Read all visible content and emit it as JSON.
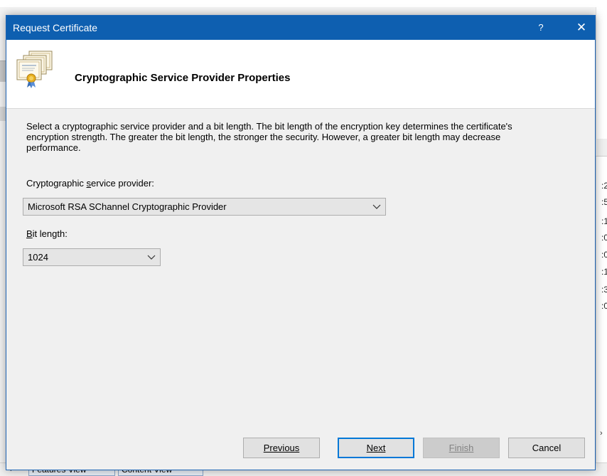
{
  "background": {
    "right_rows": [
      ":2",
      ":5",
      ":1",
      ":0",
      ":0",
      ":1",
      ":3",
      ":0"
    ],
    "bottom_tabs": [
      "Features View",
      "Content View"
    ]
  },
  "dialog": {
    "title": "Request Certificate",
    "help_glyph": "?",
    "close_glyph": "✕",
    "header_title": "Cryptographic Service Provider Properties",
    "description": "Select a cryptographic service provider and a bit length. The bit length of the encryption key determines the certificate's encryption strength. The greater the bit length, the stronger the security. However, a greater bit length may decrease performance.",
    "csp_label_pre": "Cryptographic ",
    "csp_label_accel": "s",
    "csp_label_post": "ervice provider:",
    "csp_value": "Microsoft RSA SChannel Cryptographic Provider",
    "bit_label_accel": "B",
    "bit_label_post": "it length:",
    "bit_value": "1024",
    "buttons": {
      "previous": "Previous",
      "next": "Next",
      "finish": "Finish",
      "cancel": "Cancel"
    }
  },
  "colors": {
    "titlebar": "#0e5fb0",
    "default_button_border": "#0078d7"
  }
}
